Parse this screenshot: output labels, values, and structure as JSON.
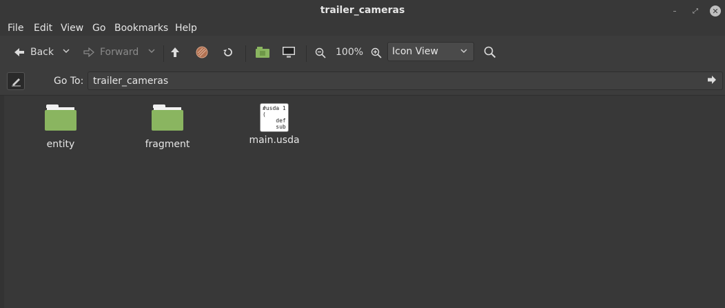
{
  "window": {
    "title": "trailer_cameras",
    "min": "–",
    "max": "⤢",
    "close": "✕"
  },
  "menubar": {
    "items": [
      "File",
      "Edit",
      "View",
      "Go",
      "Bookmarks",
      "Help"
    ]
  },
  "toolbar": {
    "back_label": "Back",
    "forward_label": "Forward",
    "zoom_level": "100%",
    "view_mode": "Icon View",
    "icons": [
      "back-arrow-icon",
      "chevron-down-icon",
      "forward-arrow-icon",
      "up-arrow-icon",
      "stop-icon",
      "reload-icon",
      "home-icon",
      "computer-icon",
      "zoom-out-icon",
      "zoom-in-icon",
      "search-icon"
    ]
  },
  "location": {
    "label": "Go To:",
    "value": "trailer_cameras"
  },
  "files": [
    {
      "name": "entity",
      "type": "folder"
    },
    {
      "name": "fragment",
      "type": "folder"
    },
    {
      "name": "main.usda",
      "type": "text",
      "preview": "#usda 1\n(\n    def\n    sub"
    }
  ],
  "colors": {
    "folder": "#8ab560",
    "background": "#383838",
    "toolbar": "#3c3c3c"
  }
}
